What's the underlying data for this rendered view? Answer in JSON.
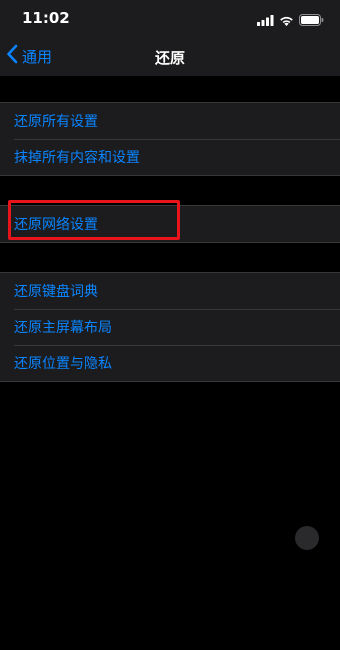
{
  "status_bar": {
    "time": "11:02",
    "icons": [
      "signal-icon",
      "wifi-icon",
      "battery-icon"
    ]
  },
  "nav": {
    "back_label": "通用",
    "title": "还原"
  },
  "groups": [
    {
      "items": [
        {
          "label": "还原所有设置"
        },
        {
          "label": "抹掉所有内容和设置"
        }
      ]
    },
    {
      "items": [
        {
          "label": "还原网络设置",
          "highlighted": true
        }
      ]
    },
    {
      "items": [
        {
          "label": "还原键盘词典"
        },
        {
          "label": "还原主屏幕布局"
        },
        {
          "label": "还原位置与隐私"
        }
      ]
    }
  ],
  "colors": {
    "accent": "#0a84ff",
    "highlight_border": "#e8141c",
    "group_background": "#1c1c1e",
    "page_background": "#000000"
  }
}
